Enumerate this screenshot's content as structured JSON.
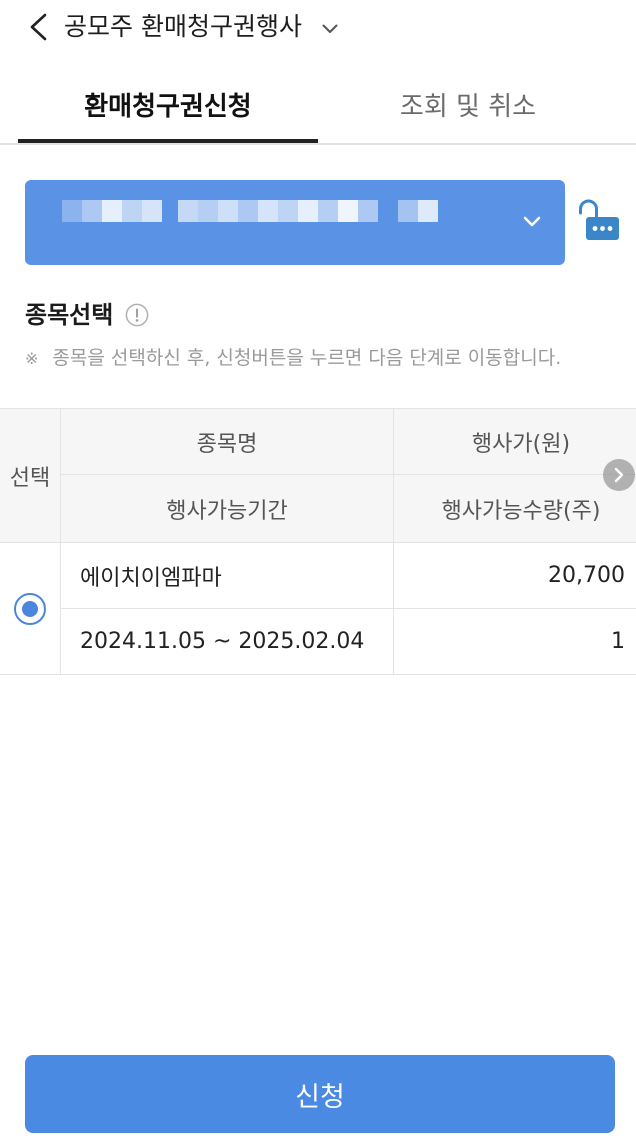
{
  "header": {
    "title": "공모주 환매청구권행사"
  },
  "tabs": [
    {
      "label": "환매청구권신청",
      "active": true
    },
    {
      "label": "조회 및 취소",
      "active": false
    }
  ],
  "section": {
    "title": "종목선택",
    "notice_mark": "※",
    "notice": "종목을 선택하신 후, 신청버튼을 누르면 다음 단계로 이동합니다."
  },
  "table": {
    "headers": {
      "select": "선택",
      "name": "종목명",
      "exercise_price": "행사가(원)",
      "exercise_period": "행사가능기간",
      "exercise_quantity": "행사가능수량(주)"
    },
    "rows": [
      {
        "selected": true,
        "name": "에이치이엠파마",
        "exercise_price": "20,700",
        "exercise_period": "2024.11.05 ~ 2025.02.04",
        "exercise_quantity": "1"
      }
    ]
  },
  "submit_button": {
    "label": "신청"
  },
  "icons": {
    "back": "chevron-left-icon",
    "title_dropdown": "chevron-down-icon",
    "account_dropdown": "chevron-down-icon",
    "account_lock": "unlock-icon",
    "section_info": "info-icon",
    "table_scroll": "chevron-right-icon"
  },
  "colors": {
    "accent": "#5a93e6",
    "button": "#4a8ae2",
    "radio": "#4a86e0",
    "lock": "#3b86c9",
    "text": "#222222",
    "muted": "#9a9a9a",
    "header_text": "#555555",
    "table_head_bg": "#f6f6f6",
    "border": "#e3e3e3"
  }
}
